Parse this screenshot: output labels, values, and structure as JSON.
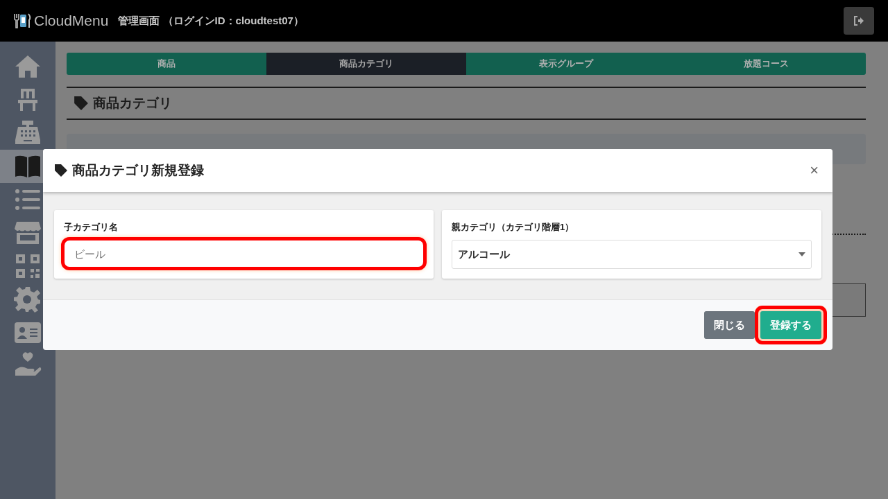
{
  "header": {
    "logo": "CloudMenu",
    "title": "管理画面 （ログインID：cloudtest07）"
  },
  "sidebar": {
    "items": [
      {
        "kind": "home",
        "selected": false
      },
      {
        "kind": "chair",
        "selected": false
      },
      {
        "kind": "register",
        "selected": false
      },
      {
        "kind": "book",
        "selected": true
      },
      {
        "kind": "list",
        "selected": false
      },
      {
        "kind": "store",
        "selected": false
      },
      {
        "kind": "qr",
        "selected": false
      },
      {
        "kind": "gear",
        "selected": false
      },
      {
        "kind": "card",
        "selected": false
      },
      {
        "kind": "hand",
        "selected": false
      }
    ]
  },
  "tabs": [
    {
      "label": "商品",
      "selected": false
    },
    {
      "label": "商品カテゴリ",
      "selected": true
    },
    {
      "label": "表示グループ",
      "selected": false
    },
    {
      "label": "放題コース",
      "selected": false
    }
  ],
  "page_heading": "商品カテゴリ",
  "modal": {
    "title": "商品カテゴリ新規登録",
    "close": "×",
    "fields": [
      {
        "kind": "text",
        "label": "子カテゴリ名",
        "placeholder": "ビール",
        "highlighted": true
      },
      {
        "kind": "select",
        "label": "親カテゴリ（カテゴリ階層1）",
        "value": "アルコール",
        "highlighted": false
      }
    ],
    "buttons": [
      {
        "kind": "secondary",
        "label": "閉じる",
        "highlighted": false
      },
      {
        "kind": "primary",
        "label": "登録する",
        "highlighted": true
      }
    ]
  }
}
